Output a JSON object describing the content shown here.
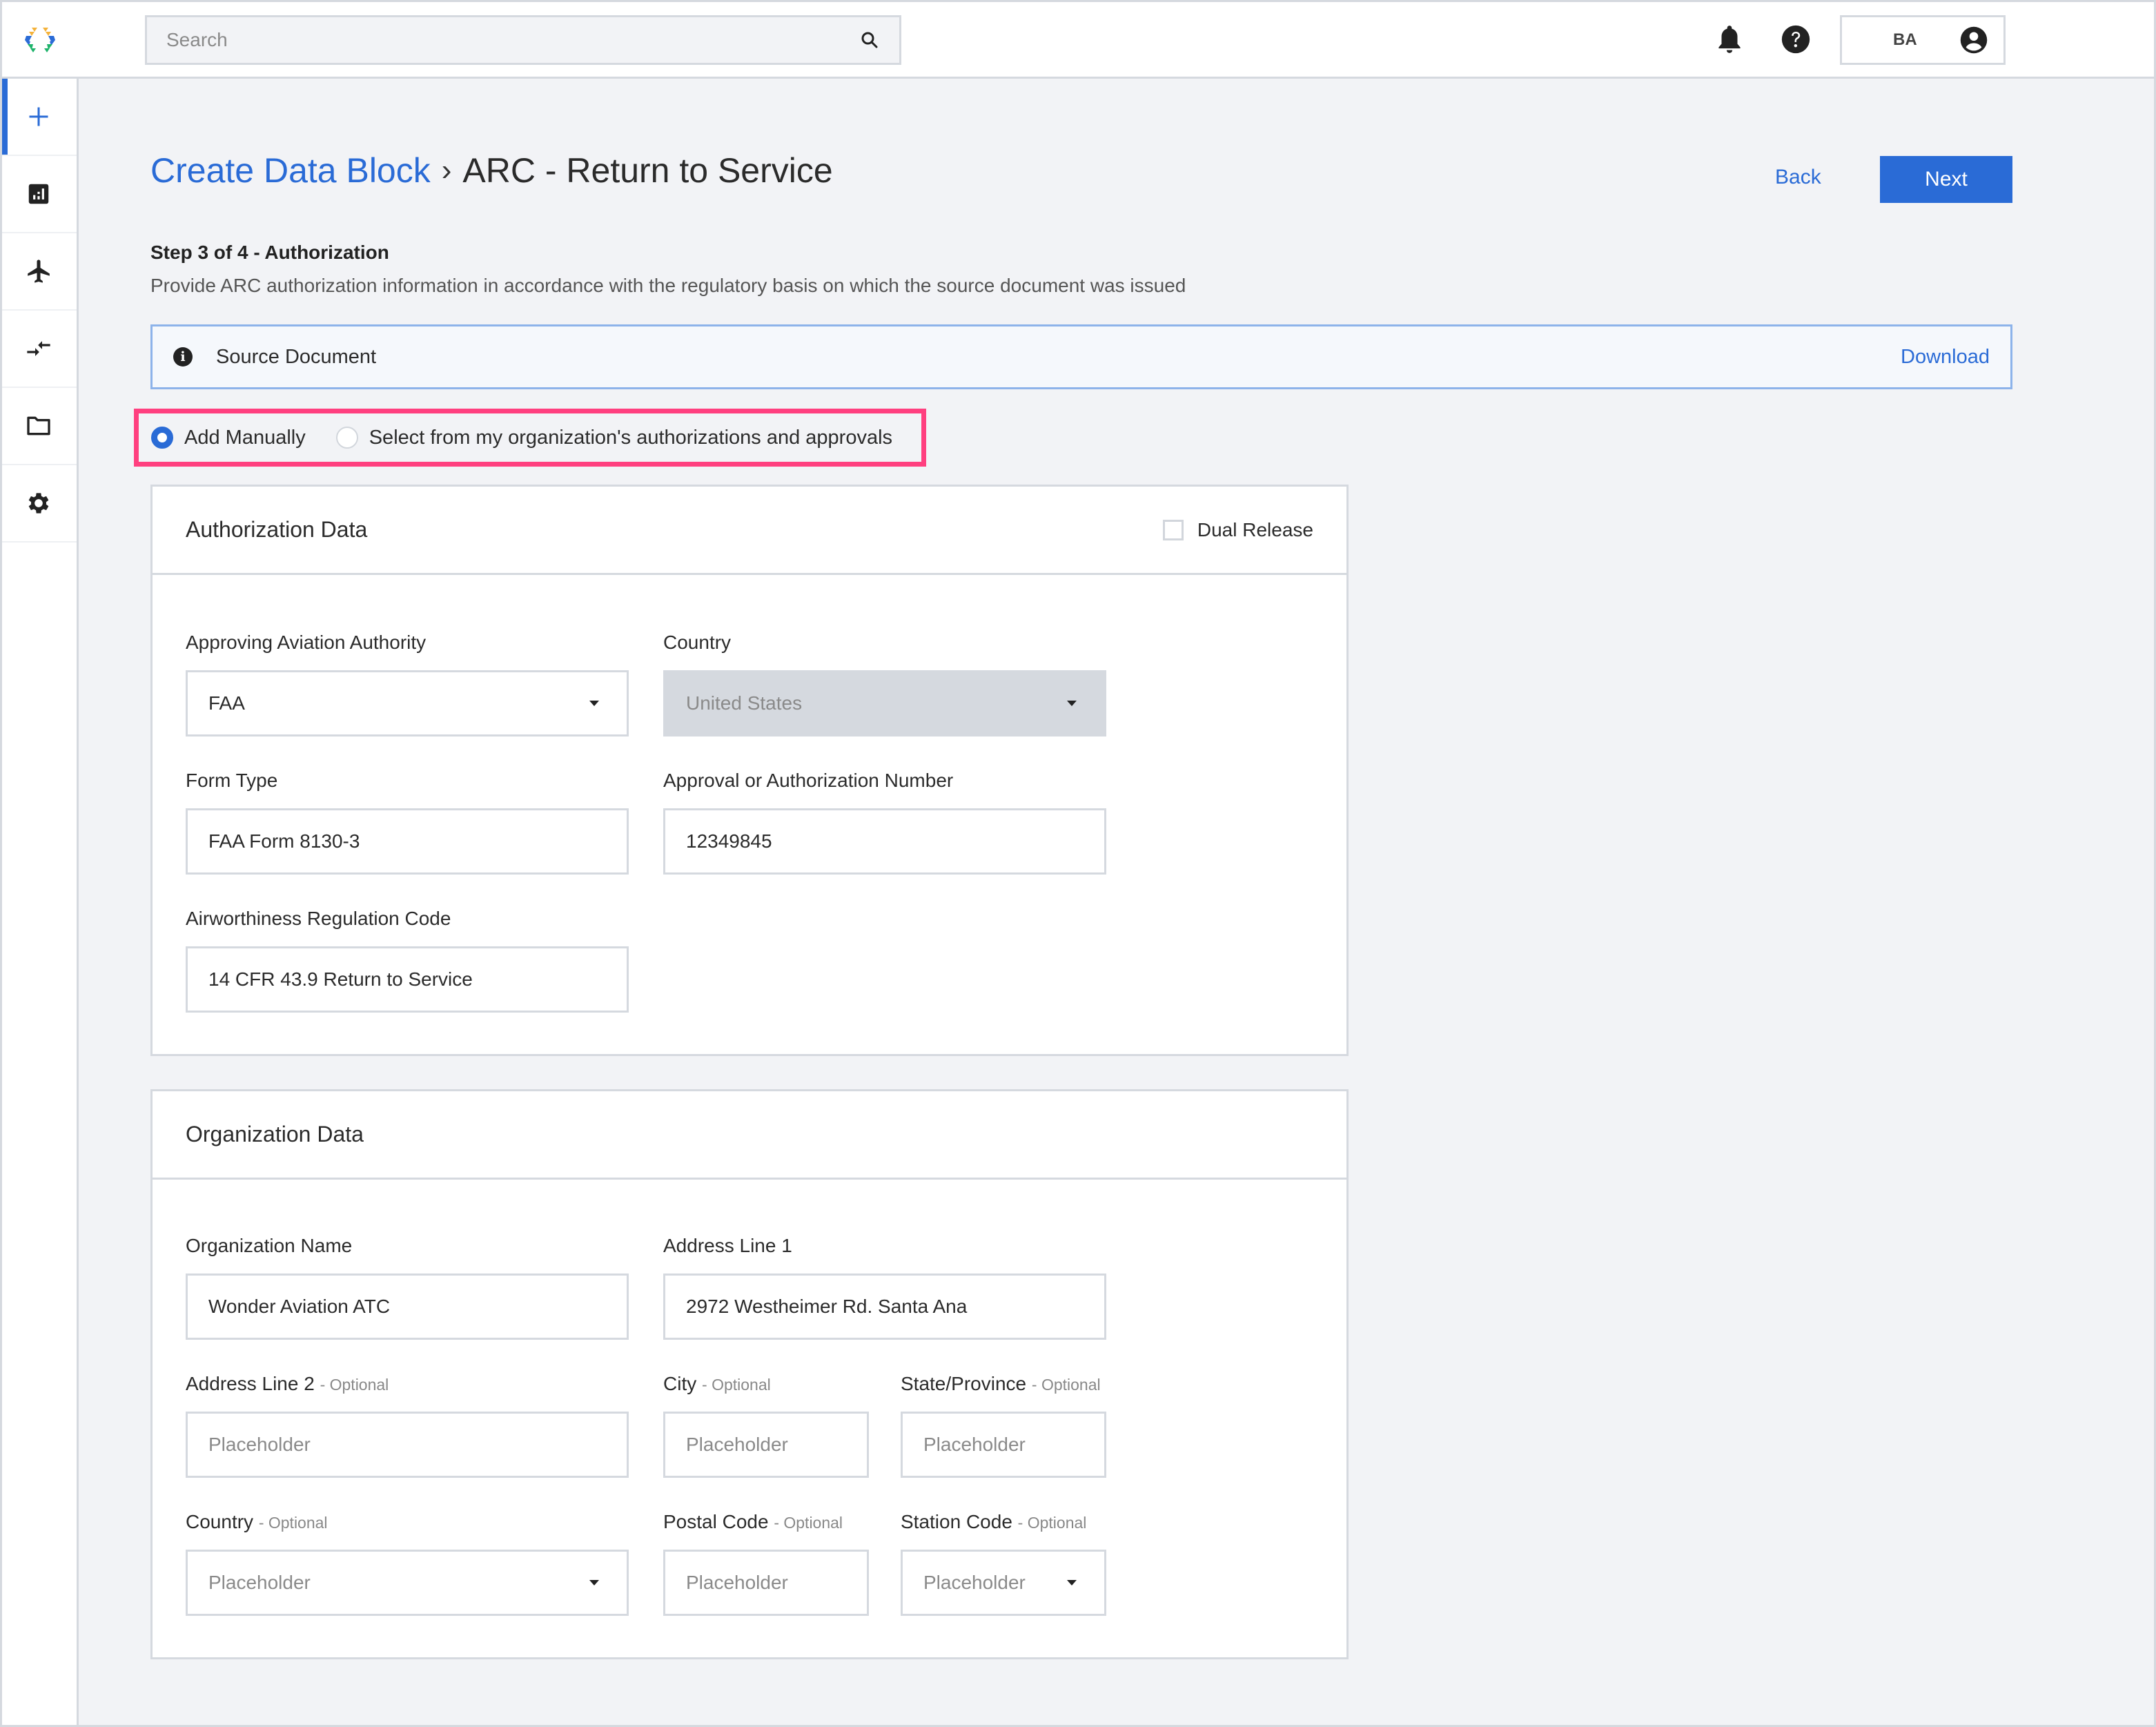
{
  "header": {
    "search_placeholder": "Search",
    "user_initials": "BA",
    "icons": [
      "logo-icon",
      "search-icon",
      "bell-icon",
      "help-icon",
      "user-avatar-icon"
    ]
  },
  "sidebar": {
    "items": [
      {
        "name": "create",
        "icon": "plus-icon",
        "active": true
      },
      {
        "name": "dashboard",
        "icon": "chart-icon",
        "active": false
      },
      {
        "name": "aircraft",
        "icon": "airplane-icon",
        "active": false
      },
      {
        "name": "transfer",
        "icon": "arrows-icon",
        "active": false
      },
      {
        "name": "files",
        "icon": "folder-icon",
        "active": false
      },
      {
        "name": "settings",
        "icon": "gear-icon",
        "active": false
      }
    ]
  },
  "page": {
    "breadcrumb_link": "Create Data Block",
    "breadcrumb_sep": "›",
    "breadcrumb_current": "ARC - Return to Service",
    "back_label": "Back",
    "next_label": "Next",
    "step_title": "Step 3 of 4 - Authorization",
    "step_desc": "Provide ARC authorization information in accordance with the regulatory basis on which the source document was issued"
  },
  "banner": {
    "label": "Source Document",
    "action": "Download"
  },
  "entry_mode": {
    "options": [
      {
        "label": "Add Manually",
        "selected": true
      },
      {
        "label": "Select from my organization's authorizations and approvals",
        "selected": false
      }
    ]
  },
  "authorization": {
    "title": "Authorization Data",
    "dual_release_label": "Dual Release",
    "dual_release_checked": false,
    "fields": {
      "authority": {
        "label": "Approving Aviation Authority",
        "value": "FAA"
      },
      "country": {
        "label": "Country",
        "value": "United States",
        "disabled": true
      },
      "form_type": {
        "label": "Form Type",
        "value": "FAA Form 8130-3"
      },
      "approval_number": {
        "label": "Approval or Authorization Number",
        "value": "12349845"
      },
      "regulation_code": {
        "label": "Airworthiness Regulation Code",
        "value": "14 CFR 43.9 Return to Service"
      }
    }
  },
  "organization": {
    "title": "Organization Data",
    "optional_suffix": "- Optional",
    "fields": {
      "org_name": {
        "label": "Organization Name",
        "value": "Wonder Aviation ATC"
      },
      "address1": {
        "label": "Address Line 1",
        "value": "2972 Westheimer Rd. Santa Ana"
      },
      "address2": {
        "label": "Address Line 2",
        "placeholder": "Placeholder"
      },
      "city": {
        "label": "City",
        "placeholder": "Placeholder"
      },
      "state": {
        "label": "State/Province",
        "placeholder": "Placeholder"
      },
      "country": {
        "label": "Country",
        "placeholder": "Placeholder"
      },
      "postal": {
        "label": "Postal Code",
        "placeholder": "Placeholder"
      },
      "station": {
        "label": "Station Code",
        "placeholder": "Placeholder"
      }
    }
  },
  "colors": {
    "accent": "#2a6bd6",
    "highlight": "#ff3f7f",
    "background": "#f2f3f6",
    "border": "#d5d9df"
  }
}
